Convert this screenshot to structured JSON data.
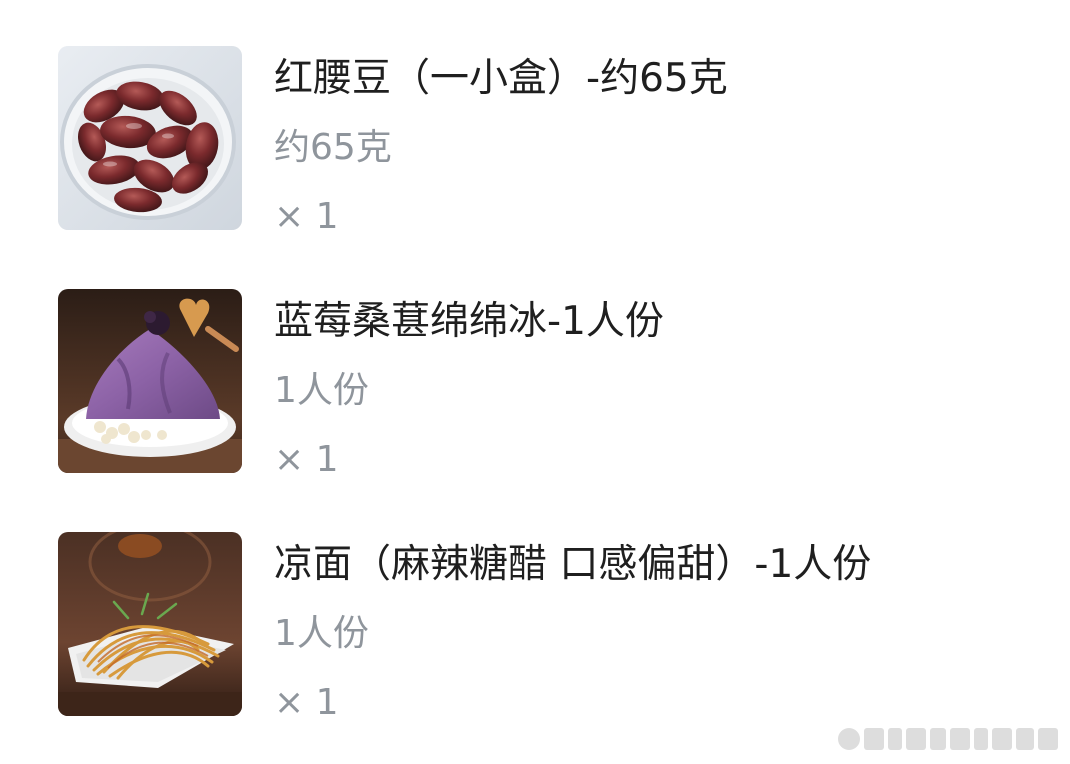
{
  "items": [
    {
      "name": "红腰豆（一小盒）-约65克",
      "spec": "约65克",
      "quantity": "× 1",
      "image_icon": "red-kidney-beans-photo"
    },
    {
      "name": "蓝莓桑葚绵绵冰-1人份",
      "spec": "1人份",
      "quantity": "× 1",
      "image_icon": "blueberry-mulberry-shaved-ice-photo"
    },
    {
      "name": "凉面（麻辣糖醋 口感偏甜）-1人份",
      "spec": "1人份",
      "quantity": "× 1",
      "image_icon": "cold-noodles-photo"
    }
  ],
  "colors": {
    "title_text": "#1f1f1f",
    "secondary_text": "#8f959c",
    "background": "#ffffff"
  }
}
